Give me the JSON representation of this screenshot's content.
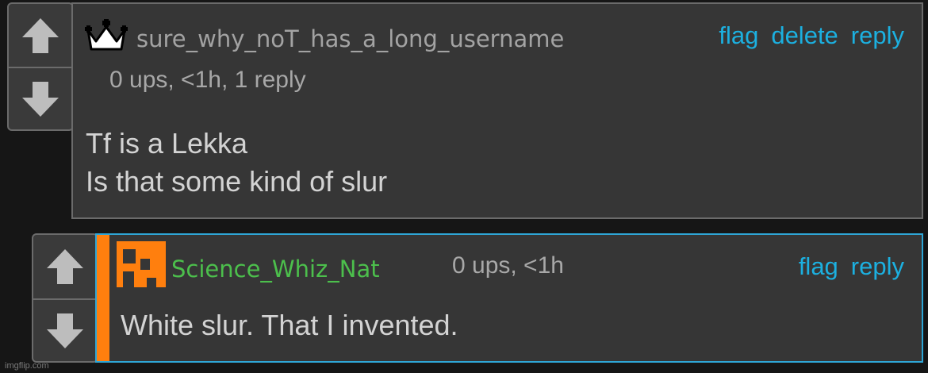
{
  "comments": [
    {
      "username": "sure_why_noT_has_a_long_username",
      "username_color": "#a3a3a3",
      "badge_icon": "crown-icon",
      "meta": "0 ups, <1h, 1 reply",
      "actions": [
        "flag",
        "delete",
        "reply"
      ],
      "body_lines": [
        "Tf is a Lekka",
        "Is that some kind of slur"
      ]
    },
    {
      "username": "Science_Whiz_Nat",
      "username_color": "#4cbf4c",
      "badge_icon": "pixel-avatar-icon",
      "meta": "0 ups, <1h",
      "actions": [
        "flag",
        "reply"
      ],
      "body_lines": [
        "White slur. That I invented."
      ],
      "accent_color": "#ff7f0e",
      "highlight_border": "#2fa6d6"
    }
  ],
  "watermark": "imgflip.com"
}
